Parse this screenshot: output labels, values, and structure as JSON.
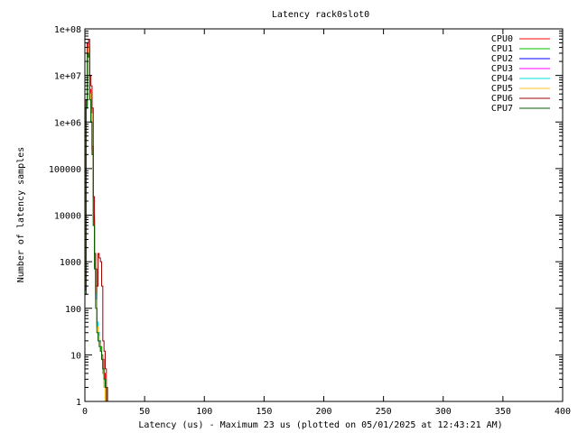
{
  "chart_data": {
    "type": "line",
    "title": "Latency rack0slot0",
    "xlabel": "Latency (us) - Maximum 23 us (plotted on 05/01/2025 at 12:43:21 AM)",
    "ylabel": "Number of latency samples",
    "xlim": [
      0,
      400
    ],
    "ylim": [
      1,
      100000000
    ],
    "y_scale": "log",
    "grid": false,
    "legend_position": "top-right",
    "x_ticks": [
      {
        "value": 0,
        "label": "0"
      },
      {
        "value": 50,
        "label": "50"
      },
      {
        "value": 100,
        "label": "100"
      },
      {
        "value": 150,
        "label": "150"
      },
      {
        "value": 200,
        "label": "200"
      },
      {
        "value": 250,
        "label": "250"
      },
      {
        "value": 300,
        "label": "300"
      },
      {
        "value": 350,
        "label": "350"
      },
      {
        "value": 400,
        "label": "400"
      }
    ],
    "y_ticks": [
      {
        "value": 1,
        "label": "1"
      },
      {
        "value": 10,
        "label": "10"
      },
      {
        "value": 100,
        "label": "100"
      },
      {
        "value": 1000,
        "label": "1000"
      },
      {
        "value": 10000,
        "label": "10000"
      },
      {
        "value": 100000,
        "label": "100000"
      },
      {
        "value": 1000000,
        "label": "1e+06"
      },
      {
        "value": 10000000,
        "label": "1e+07"
      },
      {
        "value": 100000000,
        "label": "1e+08"
      }
    ],
    "series": [
      {
        "name": "CPU0",
        "color": "#ff0000",
        "points": [
          [
            0,
            300
          ],
          [
            1,
            3000000
          ],
          [
            2,
            50000000
          ],
          [
            3,
            40000000
          ],
          [
            4,
            5000000
          ],
          [
            5,
            2000000
          ],
          [
            6,
            300000
          ],
          [
            7,
            10000
          ],
          [
            8,
            1500
          ],
          [
            9,
            300
          ],
          [
            10,
            50
          ],
          [
            11,
            30
          ],
          [
            12,
            20
          ],
          [
            13,
            15
          ],
          [
            14,
            10
          ],
          [
            15,
            8
          ],
          [
            16,
            4
          ],
          [
            17,
            2
          ],
          [
            18,
            1
          ]
        ]
      },
      {
        "name": "CPU1",
        "color": "#00c000",
        "points": [
          [
            0,
            200
          ],
          [
            1,
            2000000
          ],
          [
            2,
            30000000
          ],
          [
            3,
            25000000
          ],
          [
            4,
            3000000
          ],
          [
            5,
            1000000
          ],
          [
            6,
            200000
          ],
          [
            7,
            6000
          ],
          [
            8,
            800
          ],
          [
            9,
            150
          ],
          [
            10,
            40
          ],
          [
            11,
            25
          ],
          [
            12,
            20
          ],
          [
            13,
            15
          ],
          [
            14,
            8
          ],
          [
            15,
            5
          ],
          [
            16,
            3
          ],
          [
            17,
            1
          ]
        ]
      },
      {
        "name": "CPU2",
        "color": "#0000ff",
        "points": [
          [
            0,
            250
          ],
          [
            1,
            2500000
          ],
          [
            2,
            40000000
          ],
          [
            3,
            30000000
          ],
          [
            4,
            4000000
          ],
          [
            5,
            1500000
          ],
          [
            6,
            250000
          ],
          [
            7,
            8000
          ],
          [
            8,
            1000
          ],
          [
            9,
            200
          ],
          [
            10,
            50
          ],
          [
            11,
            30
          ],
          [
            12,
            20
          ],
          [
            13,
            12
          ],
          [
            14,
            8
          ],
          [
            15,
            4
          ],
          [
            16,
            2
          ],
          [
            17,
            1
          ]
        ]
      },
      {
        "name": "CPU3",
        "color": "#ff00ff",
        "points": [
          [
            0,
            250
          ],
          [
            1,
            2500000
          ],
          [
            2,
            40000000
          ],
          [
            3,
            30000000
          ],
          [
            4,
            4000000
          ],
          [
            5,
            1500000
          ],
          [
            6,
            250000
          ],
          [
            7,
            8000
          ],
          [
            8,
            1000
          ],
          [
            9,
            200
          ],
          [
            10,
            50
          ],
          [
            11,
            30
          ],
          [
            12,
            20
          ],
          [
            13,
            12
          ],
          [
            14,
            8
          ],
          [
            15,
            4
          ],
          [
            16,
            2
          ],
          [
            17,
            1
          ]
        ]
      },
      {
        "name": "CPU4",
        "color": "#00e0e0",
        "points": [
          [
            0,
            250
          ],
          [
            1,
            2500000
          ],
          [
            2,
            40000000
          ],
          [
            3,
            30000000
          ],
          [
            4,
            4000000
          ],
          [
            5,
            1500000
          ],
          [
            6,
            250000
          ],
          [
            7,
            8000
          ],
          [
            8,
            1000
          ],
          [
            9,
            200
          ],
          [
            10,
            50
          ],
          [
            11,
            30
          ],
          [
            12,
            20
          ],
          [
            13,
            12
          ],
          [
            14,
            8
          ],
          [
            15,
            4
          ],
          [
            16,
            2
          ],
          [
            17,
            1
          ]
        ]
      },
      {
        "name": "CPU5",
        "color": "#ffc020",
        "points": [
          [
            0,
            300
          ],
          [
            1,
            2500000
          ],
          [
            2,
            40000000
          ],
          [
            3,
            30000000
          ],
          [
            4,
            4000000
          ],
          [
            5,
            1500000
          ],
          [
            6,
            250000
          ],
          [
            7,
            8000
          ],
          [
            8,
            1000
          ],
          [
            9,
            150
          ],
          [
            10,
            40
          ],
          [
            11,
            25
          ],
          [
            12,
            18
          ],
          [
            13,
            12
          ],
          [
            14,
            8
          ],
          [
            15,
            4
          ],
          [
            16,
            2
          ],
          [
            17,
            1
          ]
        ]
      },
      {
        "name": "CPU6",
        "color": "#a00000",
        "points": [
          [
            0,
            250
          ],
          [
            1,
            3000000
          ],
          [
            2,
            50000000
          ],
          [
            3,
            60000000
          ],
          [
            4,
            10000000
          ],
          [
            5,
            6000000
          ],
          [
            6,
            2000000
          ],
          [
            7,
            25000
          ],
          [
            8,
            1500
          ],
          [
            9,
            700
          ],
          [
            10,
            300
          ],
          [
            11,
            1500
          ],
          [
            12,
            1200
          ],
          [
            13,
            1000
          ],
          [
            14,
            300
          ],
          [
            15,
            20
          ],
          [
            16,
            12
          ],
          [
            17,
            5
          ],
          [
            18,
            2
          ],
          [
            19,
            1
          ],
          [
            20,
            1
          ],
          [
            21,
            1
          ],
          [
            22,
            1
          ],
          [
            23,
            1
          ]
        ]
      },
      {
        "name": "CPU7",
        "color": "#006000",
        "points": [
          [
            0,
            200
          ],
          [
            1,
            2000000
          ],
          [
            2,
            30000000
          ],
          [
            3,
            25000000
          ],
          [
            4,
            3000000
          ],
          [
            5,
            1000000
          ],
          [
            6,
            200000
          ],
          [
            7,
            6000
          ],
          [
            8,
            700
          ],
          [
            9,
            100
          ],
          [
            10,
            30
          ],
          [
            11,
            20
          ],
          [
            12,
            15
          ],
          [
            13,
            12
          ],
          [
            14,
            8
          ],
          [
            15,
            5
          ],
          [
            16,
            3
          ],
          [
            17,
            2
          ],
          [
            18,
            1
          ]
        ]
      }
    ]
  }
}
